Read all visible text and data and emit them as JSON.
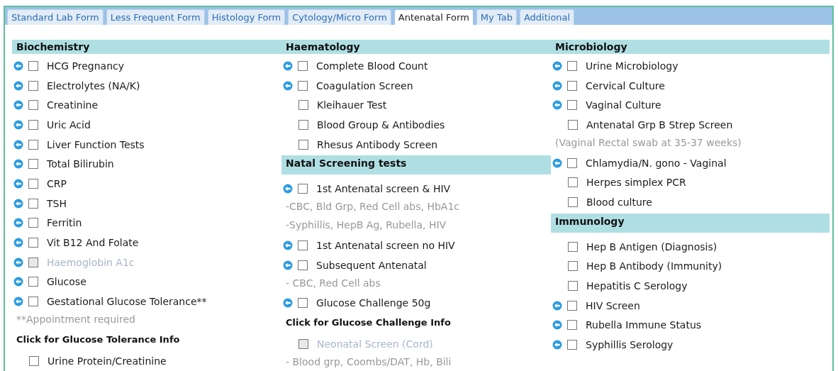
{
  "tabs": [
    {
      "label": "Standard Lab Form",
      "selected": false
    },
    {
      "label": "Less Frequent Form",
      "selected": false
    },
    {
      "label": "Histology Form",
      "selected": false
    },
    {
      "label": "Cytology/Micro Form",
      "selected": false
    },
    {
      "label": "Antenatal Form",
      "selected": true
    },
    {
      "label": "My Tab",
      "selected": false
    },
    {
      "label": "Additional",
      "selected": false
    }
  ],
  "columns": [
    {
      "entries": [
        {
          "kind": "header",
          "label": "Biochemistry"
        },
        {
          "kind": "test",
          "label": "HCG Pregnancy",
          "info": true,
          "checked": false,
          "disabled": false
        },
        {
          "kind": "test",
          "label": "Electrolytes (NA/K)",
          "info": true,
          "checked": false,
          "disabled": false
        },
        {
          "kind": "test",
          "label": "Creatinine",
          "info": true,
          "checked": false,
          "disabled": false
        },
        {
          "kind": "test",
          "label": "Uric Acid",
          "info": true,
          "checked": false,
          "disabled": false
        },
        {
          "kind": "test",
          "label": "Liver Function Tests",
          "info": true,
          "checked": false,
          "disabled": false
        },
        {
          "kind": "test",
          "label": "Total Bilirubin",
          "info": true,
          "checked": false,
          "disabled": false
        },
        {
          "kind": "test",
          "label": "CRP",
          "info": true,
          "checked": false,
          "disabled": false
        },
        {
          "kind": "test",
          "label": "TSH",
          "info": true,
          "checked": false,
          "disabled": false
        },
        {
          "kind": "test",
          "label": "Ferritin",
          "info": true,
          "checked": false,
          "disabled": false
        },
        {
          "kind": "test",
          "label": "Vit B12 And Folate",
          "info": true,
          "checked": false,
          "disabled": false
        },
        {
          "kind": "test",
          "label": "Haemoglobin A1c",
          "info": true,
          "checked": false,
          "disabled": true
        },
        {
          "kind": "test",
          "label": "Glucose",
          "info": true,
          "checked": false,
          "disabled": false
        },
        {
          "kind": "test",
          "label": "Gestational Glucose Tolerance**",
          "info": true,
          "checked": false,
          "disabled": false
        },
        {
          "kind": "note",
          "label": "**Appointment required"
        },
        {
          "kind": "link",
          "label": "Click for Glucose Tolerance Info"
        },
        {
          "kind": "test",
          "label": "Urine Protein/Creatinine",
          "info": false,
          "checked": false,
          "disabled": false
        }
      ]
    },
    {
      "entries": [
        {
          "kind": "header",
          "label": "Haematology"
        },
        {
          "kind": "test",
          "label": "Complete Blood Count",
          "info": true,
          "checked": false,
          "disabled": false
        },
        {
          "kind": "test",
          "label": "Coagulation Screen",
          "info": true,
          "checked": false,
          "disabled": false
        },
        {
          "kind": "test",
          "label": "Kleihauer Test",
          "info": false,
          "checked": false,
          "disabled": false
        },
        {
          "kind": "test",
          "label": "Blood Group & Antibodies",
          "info": false,
          "checked": false,
          "disabled": false
        },
        {
          "kind": "test",
          "label": "Rhesus Antibody Screen",
          "info": false,
          "checked": false,
          "disabled": false
        },
        {
          "kind": "header",
          "label": "Natal Screening tests"
        },
        {
          "kind": "test",
          "label": "1st Antenatal screen & HIV",
          "info": true,
          "checked": false,
          "disabled": false
        },
        {
          "kind": "note",
          "label": "-CBC, Bld Grp, Red Cell abs, HbA1c"
        },
        {
          "kind": "note",
          "label": "-Syphillis, HepB Ag, Rubella, HIV"
        },
        {
          "kind": "test",
          "label": "1st Antenatal screen no HIV",
          "info": true,
          "checked": false,
          "disabled": false
        },
        {
          "kind": "test",
          "label": "Subsequent Antenatal",
          "info": true,
          "checked": false,
          "disabled": false
        },
        {
          "kind": "note",
          "label": "- CBC, Red Cell abs"
        },
        {
          "kind": "test",
          "label": "Glucose Challenge 50g",
          "info": true,
          "checked": false,
          "disabled": false
        },
        {
          "kind": "link",
          "label": "Click for Glucose Challenge Info"
        },
        {
          "kind": "test",
          "label": "Neonatal Screen (Cord)",
          "info": false,
          "checked": false,
          "disabled": true
        },
        {
          "kind": "note",
          "label": "- Blood grp, Coombs/DAT, Hb, Bili"
        }
      ]
    },
    {
      "entries": [
        {
          "kind": "header",
          "label": "Microbiology"
        },
        {
          "kind": "test",
          "label": "Urine Microbiology",
          "info": true,
          "checked": false,
          "disabled": false
        },
        {
          "kind": "test",
          "label": "Cervical Culture",
          "info": true,
          "checked": false,
          "disabled": false
        },
        {
          "kind": "test",
          "label": "Vaginal Culture",
          "info": true,
          "checked": false,
          "disabled": false
        },
        {
          "kind": "test",
          "label": "Antenatal Grp B Strep Screen",
          "info": false,
          "checked": false,
          "disabled": false
        },
        {
          "kind": "note",
          "label": "(Vaginal Rectal swab at 35-37 weeks)"
        },
        {
          "kind": "test",
          "label": "Chlamydia/N. gono - Vaginal",
          "info": true,
          "checked": false,
          "disabled": false
        },
        {
          "kind": "test",
          "label": "Herpes simplex PCR",
          "info": false,
          "checked": false,
          "disabled": false
        },
        {
          "kind": "test",
          "label": "Blood culture",
          "info": false,
          "checked": false,
          "disabled": false
        },
        {
          "kind": "header",
          "label": "Immunology"
        },
        {
          "kind": "test",
          "label": "Hep B Antigen (Diagnosis)",
          "info": false,
          "checked": false,
          "disabled": false
        },
        {
          "kind": "test",
          "label": "Hep B Antibody (Immunity)",
          "info": false,
          "checked": false,
          "disabled": false
        },
        {
          "kind": "test",
          "label": "Hepatitis C Serology",
          "info": false,
          "checked": false,
          "disabled": false
        },
        {
          "kind": "test",
          "label": "HIV Screen",
          "info": true,
          "checked": false,
          "disabled": false
        },
        {
          "kind": "test",
          "label": "Rubella Immune Status",
          "info": true,
          "checked": false,
          "disabled": false
        },
        {
          "kind": "test",
          "label": "Syphillis Serology",
          "info": true,
          "checked": false,
          "disabled": false
        }
      ]
    }
  ]
}
